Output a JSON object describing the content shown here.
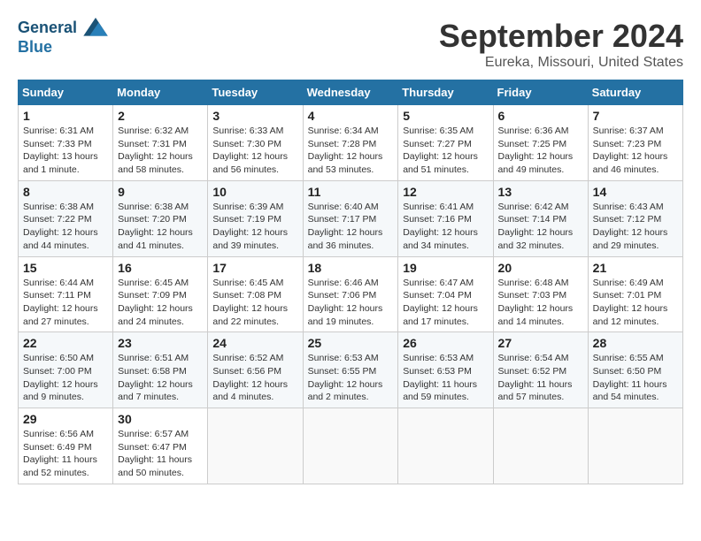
{
  "header": {
    "logo_line1": "General",
    "logo_line2": "Blue",
    "month_title": "September 2024",
    "location": "Eureka, Missouri, United States"
  },
  "days_of_week": [
    "Sunday",
    "Monday",
    "Tuesday",
    "Wednesday",
    "Thursday",
    "Friday",
    "Saturday"
  ],
  "weeks": [
    [
      {
        "day": "1",
        "sunrise": "6:31 AM",
        "sunset": "7:33 PM",
        "daylight": "13 hours and 1 minute."
      },
      {
        "day": "2",
        "sunrise": "6:32 AM",
        "sunset": "7:31 PM",
        "daylight": "12 hours and 58 minutes."
      },
      {
        "day": "3",
        "sunrise": "6:33 AM",
        "sunset": "7:30 PM",
        "daylight": "12 hours and 56 minutes."
      },
      {
        "day": "4",
        "sunrise": "6:34 AM",
        "sunset": "7:28 PM",
        "daylight": "12 hours and 53 minutes."
      },
      {
        "day": "5",
        "sunrise": "6:35 AM",
        "sunset": "7:27 PM",
        "daylight": "12 hours and 51 minutes."
      },
      {
        "day": "6",
        "sunrise": "6:36 AM",
        "sunset": "7:25 PM",
        "daylight": "12 hours and 49 minutes."
      },
      {
        "day": "7",
        "sunrise": "6:37 AM",
        "sunset": "7:23 PM",
        "daylight": "12 hours and 46 minutes."
      }
    ],
    [
      {
        "day": "8",
        "sunrise": "6:38 AM",
        "sunset": "7:22 PM",
        "daylight": "12 hours and 44 minutes."
      },
      {
        "day": "9",
        "sunrise": "6:38 AM",
        "sunset": "7:20 PM",
        "daylight": "12 hours and 41 minutes."
      },
      {
        "day": "10",
        "sunrise": "6:39 AM",
        "sunset": "7:19 PM",
        "daylight": "12 hours and 39 minutes."
      },
      {
        "day": "11",
        "sunrise": "6:40 AM",
        "sunset": "7:17 PM",
        "daylight": "12 hours and 36 minutes."
      },
      {
        "day": "12",
        "sunrise": "6:41 AM",
        "sunset": "7:16 PM",
        "daylight": "12 hours and 34 minutes."
      },
      {
        "day": "13",
        "sunrise": "6:42 AM",
        "sunset": "7:14 PM",
        "daylight": "12 hours and 32 minutes."
      },
      {
        "day": "14",
        "sunrise": "6:43 AM",
        "sunset": "7:12 PM",
        "daylight": "12 hours and 29 minutes."
      }
    ],
    [
      {
        "day": "15",
        "sunrise": "6:44 AM",
        "sunset": "7:11 PM",
        "daylight": "12 hours and 27 minutes."
      },
      {
        "day": "16",
        "sunrise": "6:45 AM",
        "sunset": "7:09 PM",
        "daylight": "12 hours and 24 minutes."
      },
      {
        "day": "17",
        "sunrise": "6:45 AM",
        "sunset": "7:08 PM",
        "daylight": "12 hours and 22 minutes."
      },
      {
        "day": "18",
        "sunrise": "6:46 AM",
        "sunset": "7:06 PM",
        "daylight": "12 hours and 19 minutes."
      },
      {
        "day": "19",
        "sunrise": "6:47 AM",
        "sunset": "7:04 PM",
        "daylight": "12 hours and 17 minutes."
      },
      {
        "day": "20",
        "sunrise": "6:48 AM",
        "sunset": "7:03 PM",
        "daylight": "12 hours and 14 minutes."
      },
      {
        "day": "21",
        "sunrise": "6:49 AM",
        "sunset": "7:01 PM",
        "daylight": "12 hours and 12 minutes."
      }
    ],
    [
      {
        "day": "22",
        "sunrise": "6:50 AM",
        "sunset": "7:00 PM",
        "daylight": "12 hours and 9 minutes."
      },
      {
        "day": "23",
        "sunrise": "6:51 AM",
        "sunset": "6:58 PM",
        "daylight": "12 hours and 7 minutes."
      },
      {
        "day": "24",
        "sunrise": "6:52 AM",
        "sunset": "6:56 PM",
        "daylight": "12 hours and 4 minutes."
      },
      {
        "day": "25",
        "sunrise": "6:53 AM",
        "sunset": "6:55 PM",
        "daylight": "12 hours and 2 minutes."
      },
      {
        "day": "26",
        "sunrise": "6:53 AM",
        "sunset": "6:53 PM",
        "daylight": "11 hours and 59 minutes."
      },
      {
        "day": "27",
        "sunrise": "6:54 AM",
        "sunset": "6:52 PM",
        "daylight": "11 hours and 57 minutes."
      },
      {
        "day": "28",
        "sunrise": "6:55 AM",
        "sunset": "6:50 PM",
        "daylight": "11 hours and 54 minutes."
      }
    ],
    [
      {
        "day": "29",
        "sunrise": "6:56 AM",
        "sunset": "6:49 PM",
        "daylight": "11 hours and 52 minutes."
      },
      {
        "day": "30",
        "sunrise": "6:57 AM",
        "sunset": "6:47 PM",
        "daylight": "11 hours and 50 minutes."
      },
      null,
      null,
      null,
      null,
      null
    ]
  ]
}
